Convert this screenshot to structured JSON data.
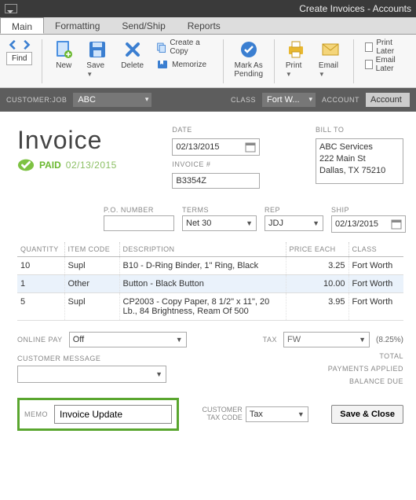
{
  "window": {
    "title": "Create Invoices - Accounts"
  },
  "tabs": {
    "main": "Main",
    "formatting": "Formatting",
    "sendship": "Send/Ship",
    "reports": "Reports"
  },
  "ribbon": {
    "find": "Find",
    "new": "New",
    "save": "Save",
    "delete": "Delete",
    "create_copy": "Create a Copy",
    "memorize": "Memorize",
    "mark_pending_l1": "Mark As",
    "mark_pending_l2": "Pending",
    "print": "Print",
    "email": "Email",
    "print_later": "Print Later",
    "email_later": "Email Later"
  },
  "header": {
    "customer_job_label": "CUSTOMER:JOB",
    "customer_job": "ABC",
    "class_label": "CLASS",
    "class": "Fort W...",
    "account_label": "ACCOUNT",
    "account": "Account"
  },
  "invoice": {
    "title": "Invoice",
    "paid_label": "PAID",
    "paid_date": "02/13/2015",
    "date_label": "DATE",
    "date": "02/13/2015",
    "invoice_no_label": "INVOICE #",
    "invoice_no": "B3354Z",
    "billto_label": "BILL TO",
    "billto_l1": "ABC Services",
    "billto_l2": "222 Main St",
    "billto_l3": "Dallas, TX 75210"
  },
  "row2": {
    "po_label": "P.O. NUMBER",
    "po": "",
    "terms_label": "TERMS",
    "terms": "Net 30",
    "rep_label": "REP",
    "rep": "JDJ",
    "ship_label": "SHIP",
    "ship": "02/13/2015"
  },
  "cols": {
    "qty": "QUANTITY",
    "item": "ITEM CODE",
    "desc": "DESCRIPTION",
    "price": "PRICE EACH",
    "class": "CLASS"
  },
  "lines": [
    {
      "qty": "10",
      "item": "Supl",
      "desc": "B10 - D-Ring Binder, 1\" Ring, Black",
      "price": "3.25",
      "class": "Fort Worth"
    },
    {
      "qty": "1",
      "item": "Other",
      "desc": "Button - Black Button",
      "price": "10.00",
      "class": "Fort Worth"
    },
    {
      "qty": "5",
      "item": "Supl",
      "desc": "CP2003 - Copy Paper, 8 1/2\" x 11\", 20 Lb., 84 Brightness, Ream Of 500",
      "price": "3.95",
      "class": "Fort Worth"
    }
  ],
  "lower": {
    "online_pay_label": "ONLINE PAY",
    "online_pay": "Off",
    "customer_msg_label": "CUSTOMER MESSAGE",
    "customer_msg": "",
    "tax_label": "TAX",
    "tax_code": "FW",
    "tax_rate": "(8.25%)",
    "total_label": "TOTAL",
    "payments_label": "PAYMENTS APPLIED",
    "balance_label": "BALANCE DUE"
  },
  "memo": {
    "label": "MEMO",
    "value": "Invoice Update",
    "cust_tax_label_l1": "CUSTOMER",
    "cust_tax_label_l2": "TAX CODE",
    "cust_tax": "Tax",
    "save_close": "Save & Close"
  }
}
